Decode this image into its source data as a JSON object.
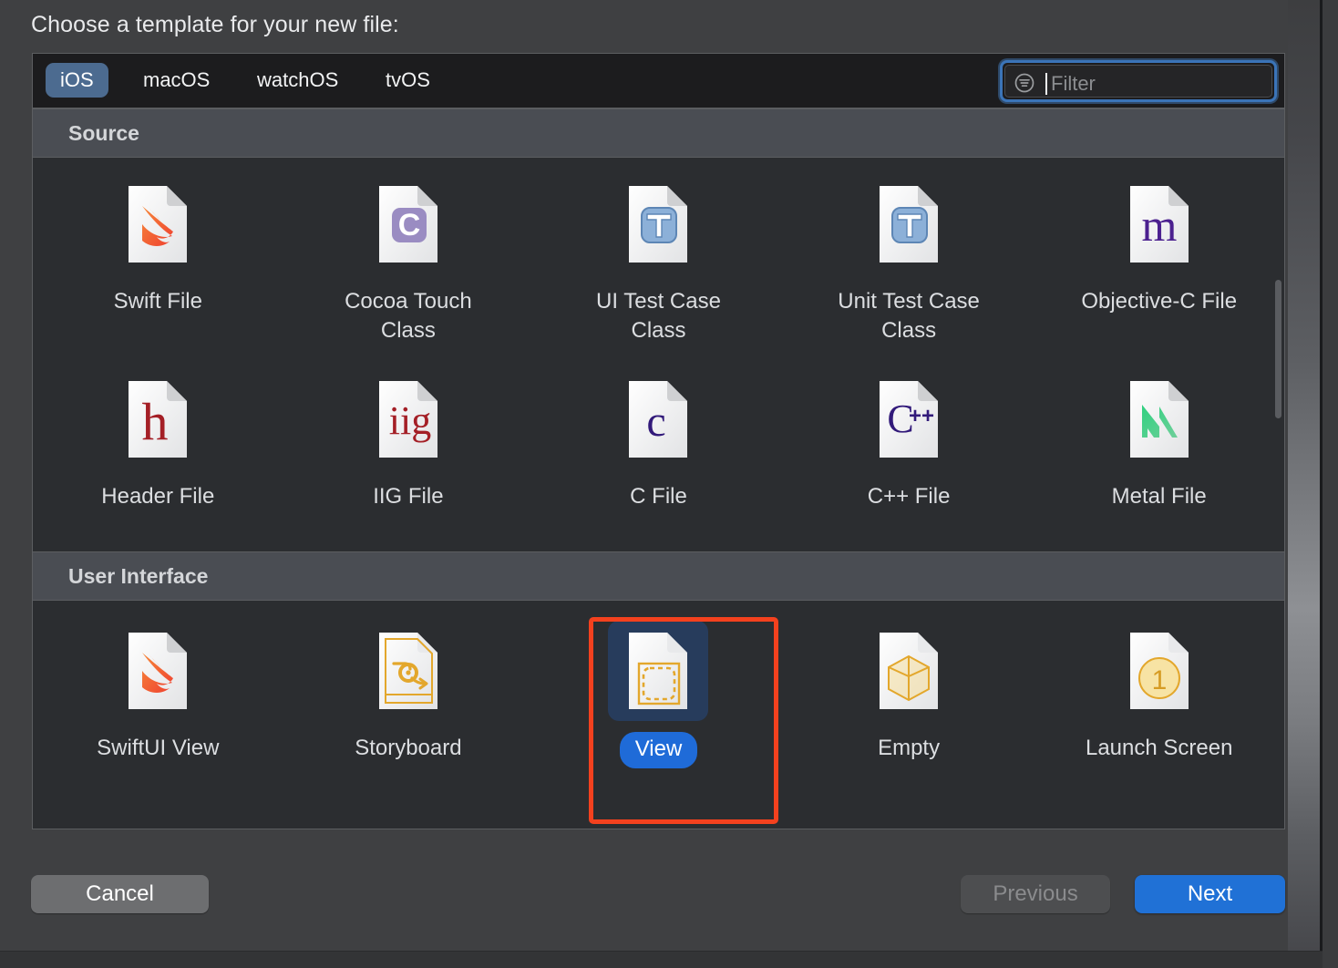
{
  "dialog": {
    "title": "Choose a template for your new file:"
  },
  "tabs": [
    {
      "label": "iOS",
      "active": true
    },
    {
      "label": "macOS",
      "active": false
    },
    {
      "label": "watchOS",
      "active": false
    },
    {
      "label": "tvOS",
      "active": false
    }
  ],
  "filter": {
    "placeholder": "Filter",
    "value": "",
    "icon": "filter-icon",
    "focused": true
  },
  "sections": [
    {
      "header": "Source",
      "items": [
        {
          "label": "Swift File",
          "icon": "swift-file-icon",
          "selected": false
        },
        {
          "label": "Cocoa Touch\nClass",
          "icon": "cocoa-touch-class-icon",
          "selected": false
        },
        {
          "label": "UI Test Case\nClass",
          "icon": "ui-test-case-icon",
          "selected": false
        },
        {
          "label": "Unit Test Case\nClass",
          "icon": "unit-test-case-icon",
          "selected": false
        },
        {
          "label": "Objective-C File",
          "icon": "objective-c-file-icon",
          "selected": false
        },
        {
          "label": "Header File",
          "icon": "header-file-icon",
          "selected": false
        },
        {
          "label": "IIG File",
          "icon": "iig-file-icon",
          "selected": false
        },
        {
          "label": "C File",
          "icon": "c-file-icon",
          "selected": false
        },
        {
          "label": "C++ File",
          "icon": "cpp-file-icon",
          "selected": false
        },
        {
          "label": "Metal File",
          "icon": "metal-file-icon",
          "selected": false
        }
      ]
    },
    {
      "header": "User Interface",
      "items": [
        {
          "label": "SwiftUI View",
          "icon": "swiftui-view-icon",
          "selected": false
        },
        {
          "label": "Storyboard",
          "icon": "storyboard-icon",
          "selected": false
        },
        {
          "label": "View",
          "icon": "view-icon",
          "selected": true
        },
        {
          "label": "Empty",
          "icon": "empty-icon",
          "selected": false
        },
        {
          "label": "Launch Screen",
          "icon": "launch-screen-icon",
          "selected": false
        }
      ]
    }
  ],
  "footer": {
    "cancel": "Cancel",
    "previous": "Previous",
    "next": "Next",
    "previous_disabled": true
  },
  "annotation": {
    "target": "View",
    "color": "#f4411e"
  },
  "colors": {
    "dialog_background": "#3f4042",
    "panel_background": "#2b2d30",
    "tabbar_background": "#1c1c1e",
    "section_header": "#4a4d53",
    "accent_blue": "#2071d6",
    "tab_active": "#4c6b90",
    "selection_tile": "#273c5c",
    "focus_ring": "#3b74b8",
    "annotation_red": "#f4411e"
  }
}
